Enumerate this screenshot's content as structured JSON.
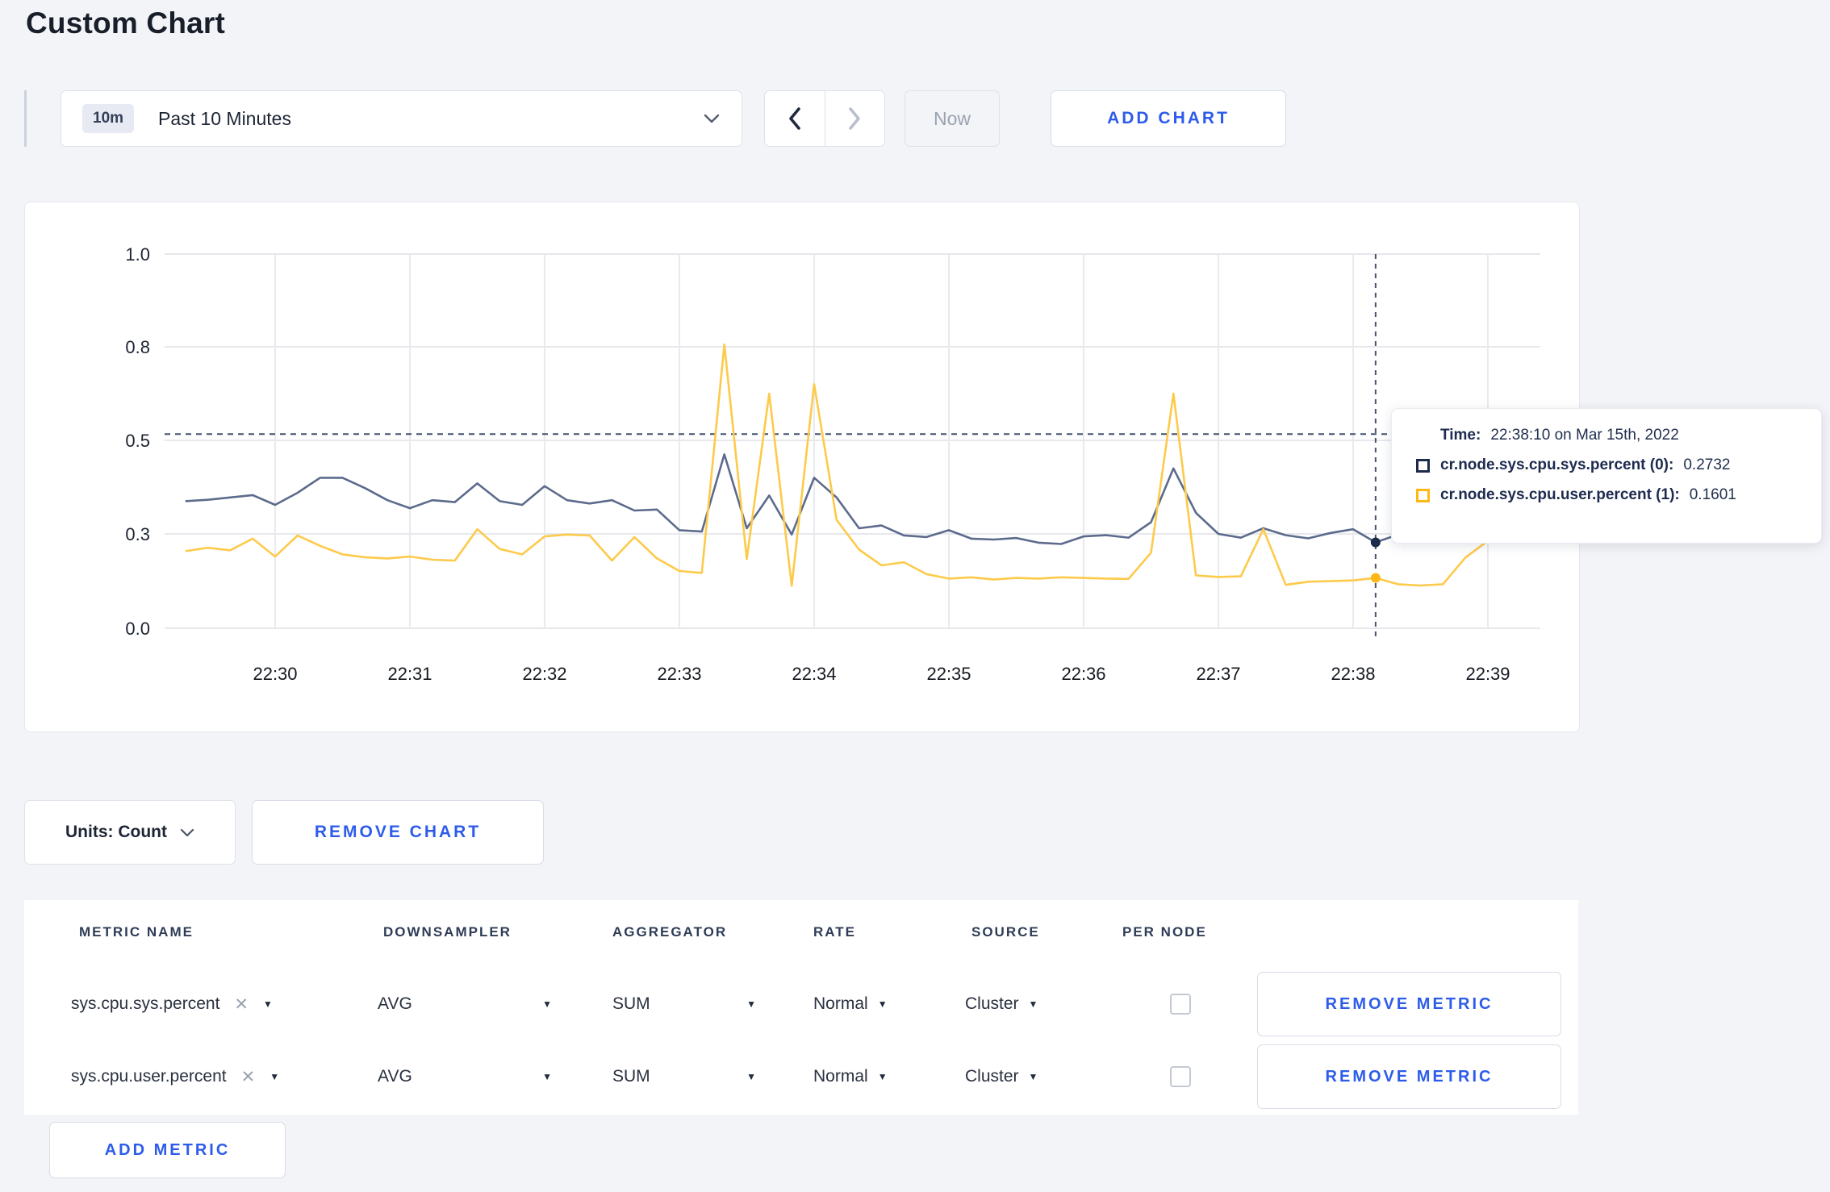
{
  "page": {
    "title": "Custom Chart"
  },
  "toolbar": {
    "time_scale": {
      "badge": "10m",
      "label": "Past 10 Minutes"
    },
    "now_label": "Now",
    "add_chart_label": "ADD CHART"
  },
  "chart_data": {
    "type": "line",
    "title": "",
    "xlabel": "",
    "ylabel": "",
    "x_start_time": "22:29:20",
    "x_interval_seconds": 10,
    "x_tick_labels": [
      "22:30",
      "22:31",
      "22:32",
      "22:33",
      "22:34",
      "22:35",
      "22:36",
      "22:37",
      "22:38",
      "22:39"
    ],
    "y_tick_labels": [
      "0.0",
      "0.3",
      "0.5",
      "0.8",
      "1.0"
    ],
    "y_tick_values": [
      0,
      0.3,
      0.5,
      0.8,
      1.0
    ],
    "grid": true,
    "legend_position": "none",
    "axis_note": "y ticks evenly spaced (non-linear scale)",
    "series": [
      {
        "name": "cr.node.sys.cpu.sys.percent (0)",
        "color": "#5c6b8c",
        "swatch_color": "#1c2b4a",
        "values": [
          0.37,
          0.373,
          0.378,
          0.383,
          0.362,
          0.388,
          0.42,
          0.42,
          0.398,
          0.372,
          0.355,
          0.372,
          0.368,
          0.408,
          0.37,
          0.362,
          0.402,
          0.372,
          0.365,
          0.372,
          0.35,
          0.352,
          0.308,
          0.305,
          0.47,
          0.312,
          0.382,
          0.298,
          0.42,
          0.378,
          0.312,
          0.318,
          0.295,
          0.29,
          0.308,
          0.285,
          0.282,
          0.287,
          0.272,
          0.268,
          0.292,
          0.296,
          0.288,
          0.325,
          0.44,
          0.345,
          0.3,
          0.288,
          0.312,
          0.296,
          0.286,
          0.302,
          0.31,
          0.2732,
          0.298,
          0.31,
          0.322,
          0.305,
          0.312
        ]
      },
      {
        "name": "cr.node.sys.cpu.user.percent (1)",
        "color": "#fdca4a",
        "swatch_color": "#fdb818",
        "values": [
          0.245,
          0.256,
          0.248,
          0.285,
          0.228,
          0.295,
          0.262,
          0.235,
          0.226,
          0.222,
          0.228,
          0.218,
          0.215,
          0.31,
          0.252,
          0.235,
          0.292,
          0.298,
          0.295,
          0.215,
          0.29,
          0.222,
          0.182,
          0.176,
          0.805,
          0.22,
          0.65,
          0.135,
          0.68,
          0.33,
          0.25,
          0.2,
          0.21,
          0.172,
          0.158,
          0.162,
          0.155,
          0.16,
          0.158,
          0.162,
          0.16,
          0.158,
          0.157,
          0.24,
          0.65,
          0.168,
          0.163,
          0.165,
          0.31,
          0.138,
          0.148,
          0.15,
          0.152,
          0.1601,
          0.14,
          0.136,
          0.14,
          0.225,
          0.278
        ]
      }
    ],
    "crosshair": {
      "hover_index": 53,
      "hover_time": "22:38:10",
      "mouse_y_value": 0.52
    }
  },
  "tooltip": {
    "time_label": "Time:",
    "time_value": "22:38:10 on Mar 15th, 2022",
    "rows": [
      {
        "name": "cr.node.sys.cpu.sys.percent (0):",
        "value": "0.2732"
      },
      {
        "name": "cr.node.sys.cpu.user.percent (1):",
        "value": "0.1601"
      }
    ]
  },
  "units": {
    "label": "Units: Count"
  },
  "remove_chart_label": "REMOVE CHART",
  "metrics_table": {
    "columns": [
      "METRIC NAME",
      "DOWNSAMPLER",
      "AGGREGATOR",
      "RATE",
      "SOURCE",
      "PER NODE"
    ],
    "remove_metric_label": "REMOVE METRIC",
    "add_metric_label": "ADD METRIC",
    "rows": [
      {
        "name": "sys.cpu.sys.percent",
        "downsampler": "AVG",
        "aggregator": "SUM",
        "rate": "Normal",
        "source": "Cluster",
        "per_node_checked": false
      },
      {
        "name": "sys.cpu.user.percent",
        "downsampler": "AVG",
        "aggregator": "SUM",
        "rate": "Normal",
        "source": "Cluster",
        "per_node_checked": false
      }
    ]
  },
  "colors": {
    "accent_blue": "#2d5cea",
    "crosshair": "#44536e",
    "gridline": "#e7e8ec"
  }
}
